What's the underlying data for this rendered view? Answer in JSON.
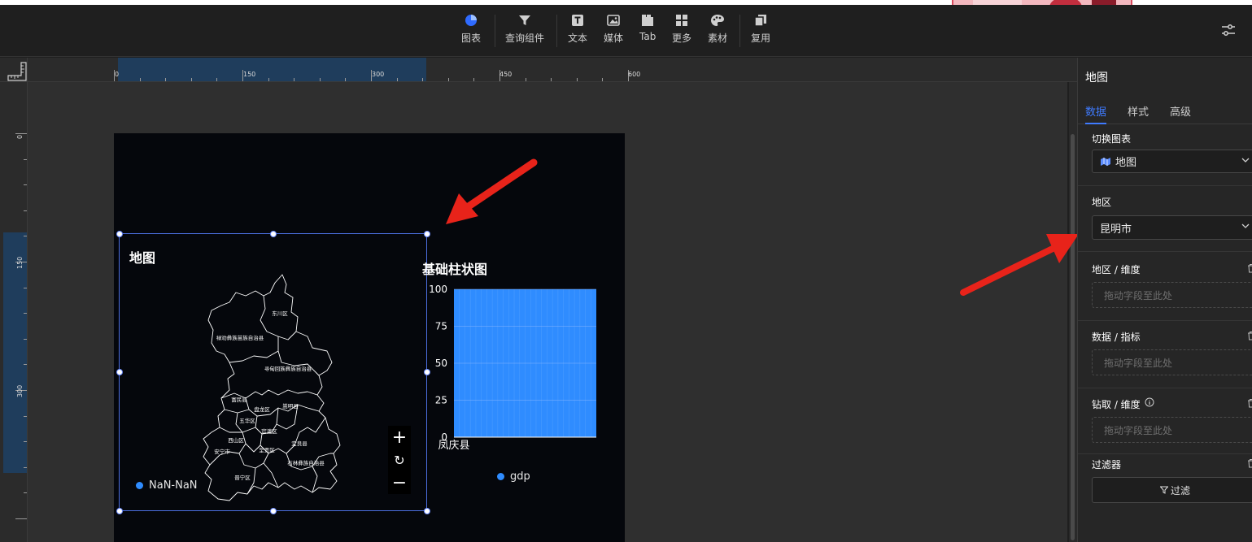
{
  "toolbar": {
    "items": [
      {
        "label": "图表",
        "icon": "pie-chart-icon"
      },
      {
        "label": "查询组件",
        "icon": "filter-funnel-icon"
      },
      {
        "label": "文本",
        "icon": "text-icon"
      },
      {
        "label": "媒体",
        "icon": "image-icon"
      },
      {
        "label": "Tab",
        "icon": "tab-icon"
      },
      {
        "label": "更多",
        "icon": "grid-more-icon"
      },
      {
        "label": "素材",
        "icon": "palette-icon"
      },
      {
        "label": "复用",
        "icon": "copy-icon"
      }
    ],
    "settings_icon": "sliders-icon"
  },
  "ruler": {
    "h_labels": [
      "0",
      "150",
      "300",
      "450",
      "600"
    ],
    "v_labels": [
      "0",
      "150",
      "300"
    ]
  },
  "canvas": {
    "map": {
      "title": "地图",
      "regions": [
        "东川区",
        "禄劝彝族苗族自治县",
        "寻甸回族彝族自治县",
        "富民县",
        "盘龙区",
        "嵩明县",
        "五华区",
        "官渡区",
        "西山区",
        "安宁市",
        "呈贡区",
        "宜良县",
        "石林彝族自治县",
        "晋宁区"
      ],
      "legend": "NaN-NaN",
      "zoom_in": "+",
      "reset": "↻",
      "zoom_out": "−"
    },
    "bar": {
      "title": "基础柱状图",
      "legend": "gdp"
    }
  },
  "chart_data": {
    "type": "bar",
    "title": "基础柱状图",
    "categories": [
      "凤庆县"
    ],
    "series": [
      {
        "name": "gdp",
        "values": [
          100
        ]
      }
    ],
    "yticks": [
      0,
      25,
      50,
      75,
      100
    ],
    "ylim": [
      0,
      100
    ],
    "grid": true,
    "legend_position": "bottom",
    "color": "#2f8cff"
  },
  "panel": {
    "title": "地图",
    "tabs": [
      "数据",
      "样式",
      "高级"
    ],
    "active_tab": "数据",
    "switch_chart_label": "切换图表",
    "switch_chart_value": "地图",
    "region_label": "地区",
    "region_value": "昆明市",
    "dim_label": "地区 / 维度",
    "dim_placeholder": "拖动字段至此处",
    "metric_label": "数据 / 指标",
    "metric_placeholder": "拖动字段至此处",
    "drill_label": "钻取 / 维度",
    "drill_placeholder": "拖动字段至此处",
    "filter_label": "过滤器",
    "filter_button": "过滤"
  },
  "colors": {
    "accent": "#3f7bff",
    "arrow": "#e8231a",
    "bar": "#2f8cff"
  }
}
